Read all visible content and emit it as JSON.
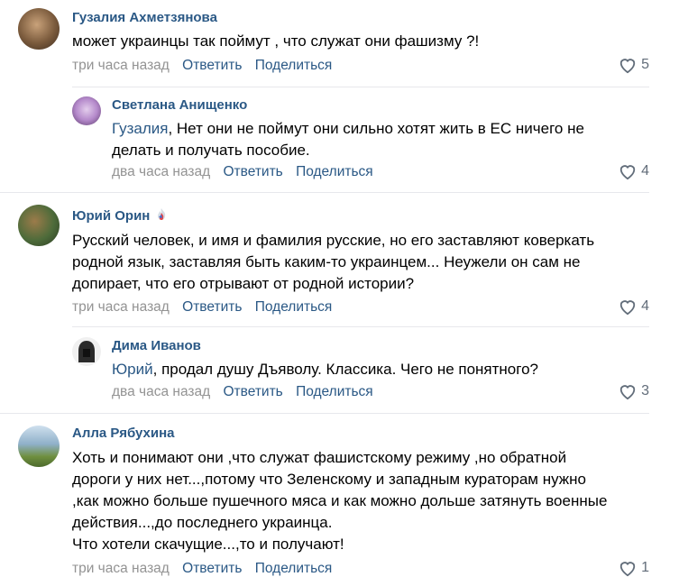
{
  "actions": {
    "reply": "Ответить",
    "share": "Поделиться"
  },
  "comments": [
    {
      "author": "Гузалия Ахметзянова",
      "text": "может украинцы так поймут , что служат они фашизму ?!",
      "time": "три часа назад",
      "likes": "5",
      "avatar_color": "#7a5a3c"
    },
    {
      "author": "Светлана Анищенко",
      "reply_to": "Гузалия",
      "text": ", Нет они не поймут они сильно хотят жить в ЕС ничего не\nделать и получать пособие.",
      "time": "два часа назад",
      "likes": "4",
      "avatar_color": "#b58acb"
    },
    {
      "author": "Юрий Орин",
      "text": "Русский человек, и имя и фамилия русские, но его заставляют коверкать\nродной язык, заставляя быть каким-то украинцем... Неужели он сам не\nдопирает, что его отрывают от родной истории?",
      "time": "три часа назад",
      "likes": "4",
      "avatar_color": "#4d6b3a"
    },
    {
      "author": "Дима Иванов",
      "reply_to": "Юрий",
      "text": ", продал душу Дъяволу. Классика. Чего не понятного?",
      "time": "два часа назад",
      "likes": "3",
      "avatar_color": "#2b2b2b"
    },
    {
      "author": "Алла Рябухина",
      "text": "Хоть и понимают они ,что служат фашистскому режиму ,но обратной\nдороги у них нет...,потому что Зеленскому и западным кураторам нужно\n,как можно больше пушечного мяса и как можно дольше затянуть военные\nдействия...,до последнего украинца.\nЧто хотели скачущие...,то и получают!",
      "time": "три часа назад",
      "likes": "1",
      "avatar_color": "#8fb0c9"
    }
  ],
  "colors": {
    "link": "#2a5885",
    "meta": "#939393",
    "divider": "#e7e8ec"
  }
}
